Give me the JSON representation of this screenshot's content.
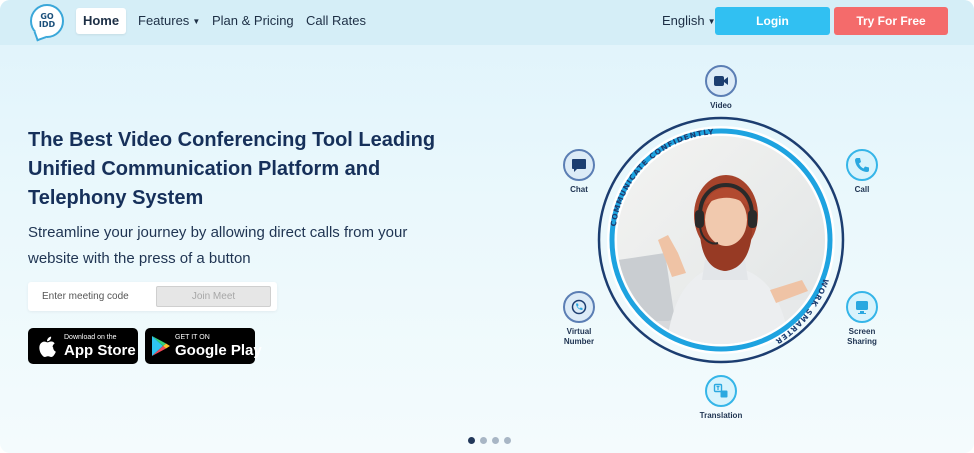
{
  "nav": {
    "logo_line1": "GO",
    "logo_line2": "IDD",
    "home": "Home",
    "features": "Features",
    "plan_pricing": "Plan & Pricing",
    "call_rates": "Call Rates",
    "language": "English",
    "login": "Login",
    "try_free": "Try For Free"
  },
  "hero": {
    "title": "The Best Video Conferencing Tool Leading Unified Communication Platform and Telephony System",
    "subtitle": "Streamline your journey by allowing direct calls from your website with the press of a button",
    "meeting_placeholder": "Enter meeting code",
    "join_button": "Join Meet"
  },
  "stores": {
    "apple_small": "Download on the",
    "apple_big": "App Store",
    "google_small": "GET IT ON",
    "google_big": "Google Play"
  },
  "graphic": {
    "ring_text_top": "COMMUNICATE CONFIDENTLY",
    "ring_text_bottom": "WORK SMARTER",
    "features": {
      "video": "Video",
      "call": "Call",
      "chat": "Chat",
      "virtual_number_1": "Virtual",
      "virtual_number_2": "Number",
      "screen_sharing_1": "Screen",
      "screen_sharing_2": "Sharing",
      "translation": "Translation"
    }
  },
  "carousel": {
    "count": 4,
    "active_index": 0
  },
  "colors": {
    "brand_blue": "#31c0f2",
    "brand_red": "#f46b6b",
    "navy": "#16305a",
    "ring": "#1ea3e0"
  },
  "icons": [
    "video-icon",
    "call-icon",
    "chat-icon",
    "virtual-number-icon",
    "screen-sharing-icon",
    "translation-icon",
    "apple-icon",
    "google-play-icon",
    "caret-down-icon"
  ]
}
